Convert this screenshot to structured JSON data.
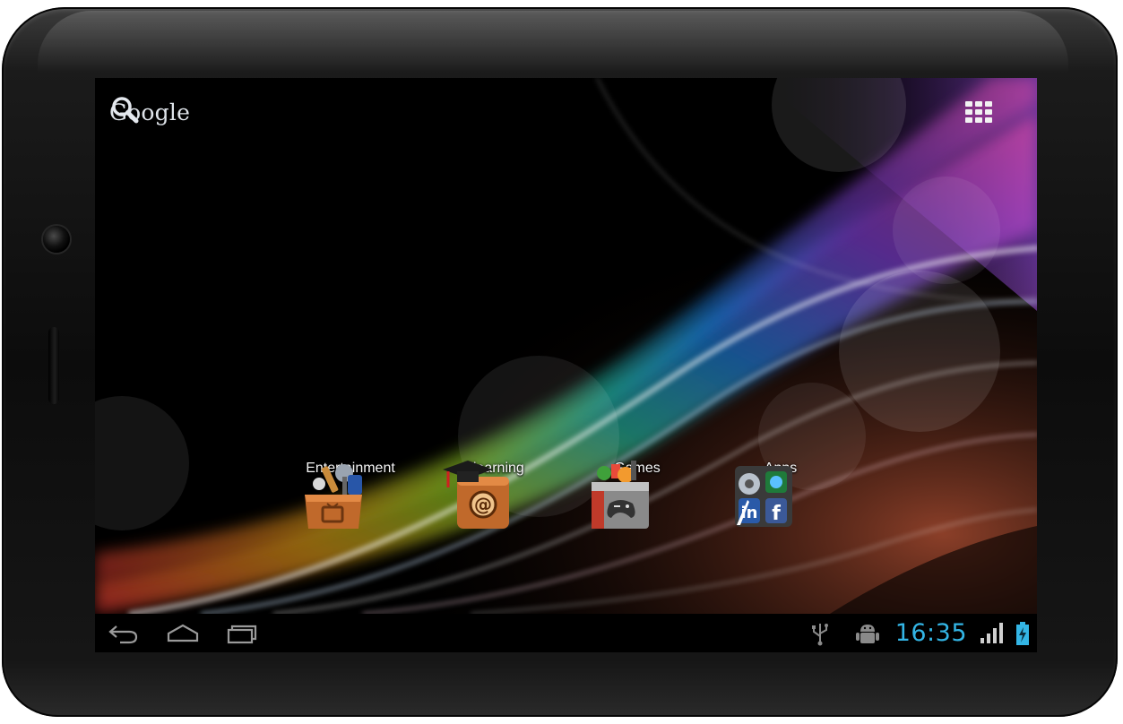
{
  "home": {
    "search": {
      "label": "Google",
      "icon": "search-icon"
    },
    "apps_button_icon": "apps-grid-icon",
    "folders": [
      {
        "label": "Entertainment",
        "icon": "entertainment-folder-icon"
      },
      {
        "label": "Elearning",
        "icon": "elearning-folder-icon"
      },
      {
        "label": "Games",
        "icon": "games-folder-icon"
      },
      {
        "label": "Apps",
        "icon": "apps-folder-icon"
      }
    ]
  },
  "system_bar": {
    "nav": [
      "back-icon",
      "home-icon",
      "recent-apps-icon"
    ],
    "notifications": [
      "usb-icon",
      "android-debug-icon"
    ],
    "clock": "16:35",
    "signal_icon": "signal-bars-icon",
    "battery_icon": "battery-charging-icon"
  },
  "colors": {
    "clock": "#33b5e5",
    "bezel": "#0c0c0c",
    "label": "#f4f4f4"
  }
}
